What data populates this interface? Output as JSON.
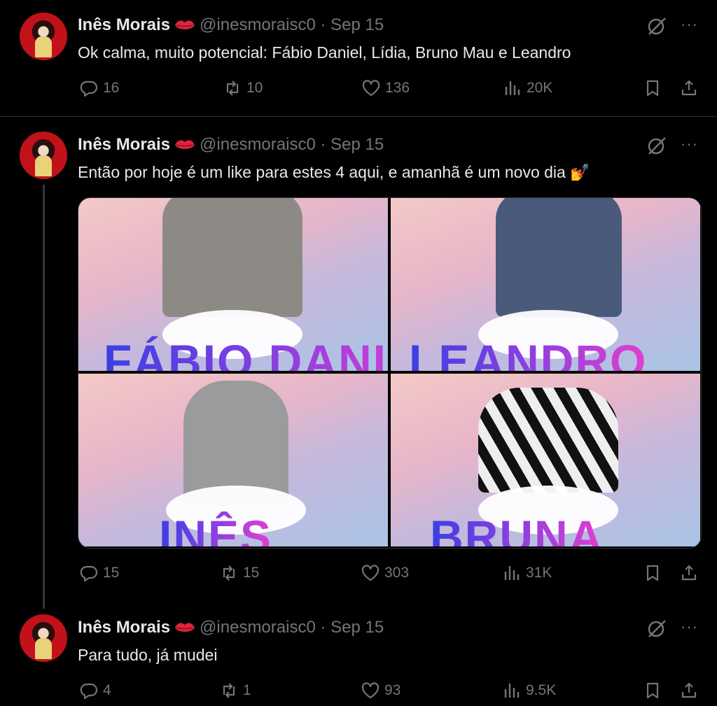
{
  "tweets": [
    {
      "name": "Inês Morais",
      "handle": "@inesmoraisc0",
      "dot": "·",
      "date": "Sep 15",
      "text": "Ok calma, muito potencial: Fábio Daniel, Lídia, Bruno Mau e Leandro",
      "replies": "16",
      "reposts": "10",
      "likes": "136",
      "views": "20K"
    },
    {
      "name": "Inês Morais",
      "handle": "@inesmoraisc0",
      "dot": "·",
      "date": "Sep 15",
      "text": "Então por hoje é um like para estes 4 aqui, e amanhã é um novo dia 💅",
      "replies": "15",
      "reposts": "15",
      "likes": "303",
      "views": "31K",
      "media": [
        "FÁBIO DANIEL",
        "LEANDRO",
        "INÊS",
        "BRUNA"
      ]
    },
    {
      "name": "Inês Morais",
      "handle": "@inesmoraisc0",
      "dot": "·",
      "date": "Sep 15",
      "text": "Para tudo, já mudei",
      "replies": "4",
      "reposts": "1",
      "likes": "93",
      "views": "9.5K"
    }
  ],
  "icons": {
    "reply": "reply-icon",
    "repost": "repost-icon",
    "like": "like-icon",
    "views": "views-icon",
    "bookmark": "bookmark-icon",
    "share": "share-icon",
    "grok": "grok-icon",
    "more": "more-icon",
    "lips": "kiss-mark-icon"
  },
  "colors": {
    "background": "#000000",
    "text": "#e7e9ea",
    "muted": "#71767b",
    "divider": "#2f3336"
  },
  "more_glyph": "···"
}
